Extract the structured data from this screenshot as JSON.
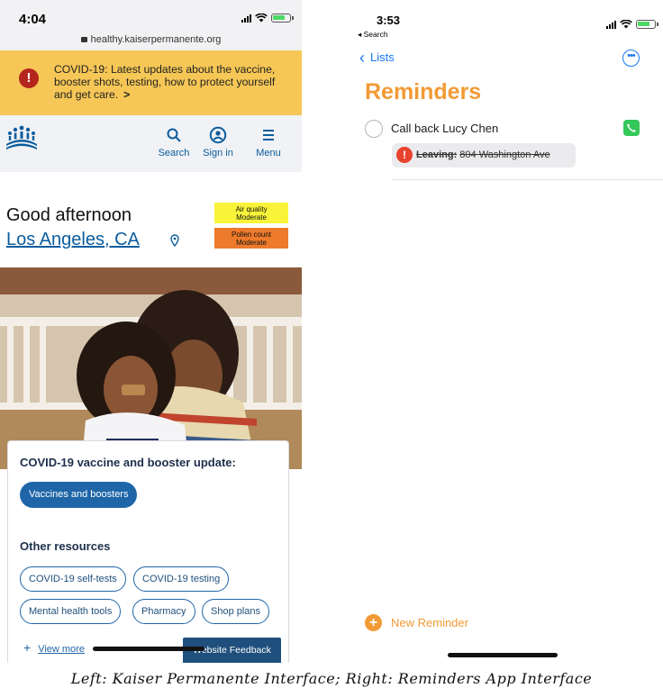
{
  "left": {
    "status": {
      "time": "4:04",
      "url": "healthy.kaiserpermanente.org"
    },
    "banner": {
      "text": "COVID-19: Latest updates about the vaccine, booster shots, testing, how to protect yourself and get care.",
      "icon": "alert-icon"
    },
    "nav": {
      "search": "Search",
      "sign_in": "Sign in",
      "menu": "Menu"
    },
    "greeting": "Good afternoon",
    "location": "Los Angeles, CA",
    "air_quality": {
      "line1": "Air quality",
      "line2": "Moderate",
      "color": "#f9f43a"
    },
    "pollen": {
      "line1": "Pollen count",
      "line2": "Moderate",
      "color": "#ee7a2b"
    },
    "card": {
      "title": "COVID-19 vaccine and booster update:",
      "primary_button": "Vaccines and boosters",
      "other_title": "Other resources",
      "pills": [
        "COVID-19 self-tests",
        "COVID-19 testing",
        "Mental health tools",
        "Pharmacy",
        "Shop plans"
      ],
      "view_more": "View more"
    },
    "feedback": "Website Feedback",
    "colors": {
      "banner": "#f6c756",
      "brand": "#0b5c9d"
    }
  },
  "right": {
    "status": {
      "time": "3:53",
      "back_app": "◂ Search"
    },
    "back_label": "Lists",
    "title": "Reminders",
    "reminder": {
      "text": "Call back Lucy Chen",
      "tag_label": "Leaving:",
      "tag_address": "804 Washington Ave"
    },
    "new_reminder": "New Reminder",
    "colors": {
      "accent": "#f29a35",
      "link": "#1677f4"
    }
  },
  "caption": "Left: Kaiser Permanente Interface; Right: Reminders App Interface"
}
